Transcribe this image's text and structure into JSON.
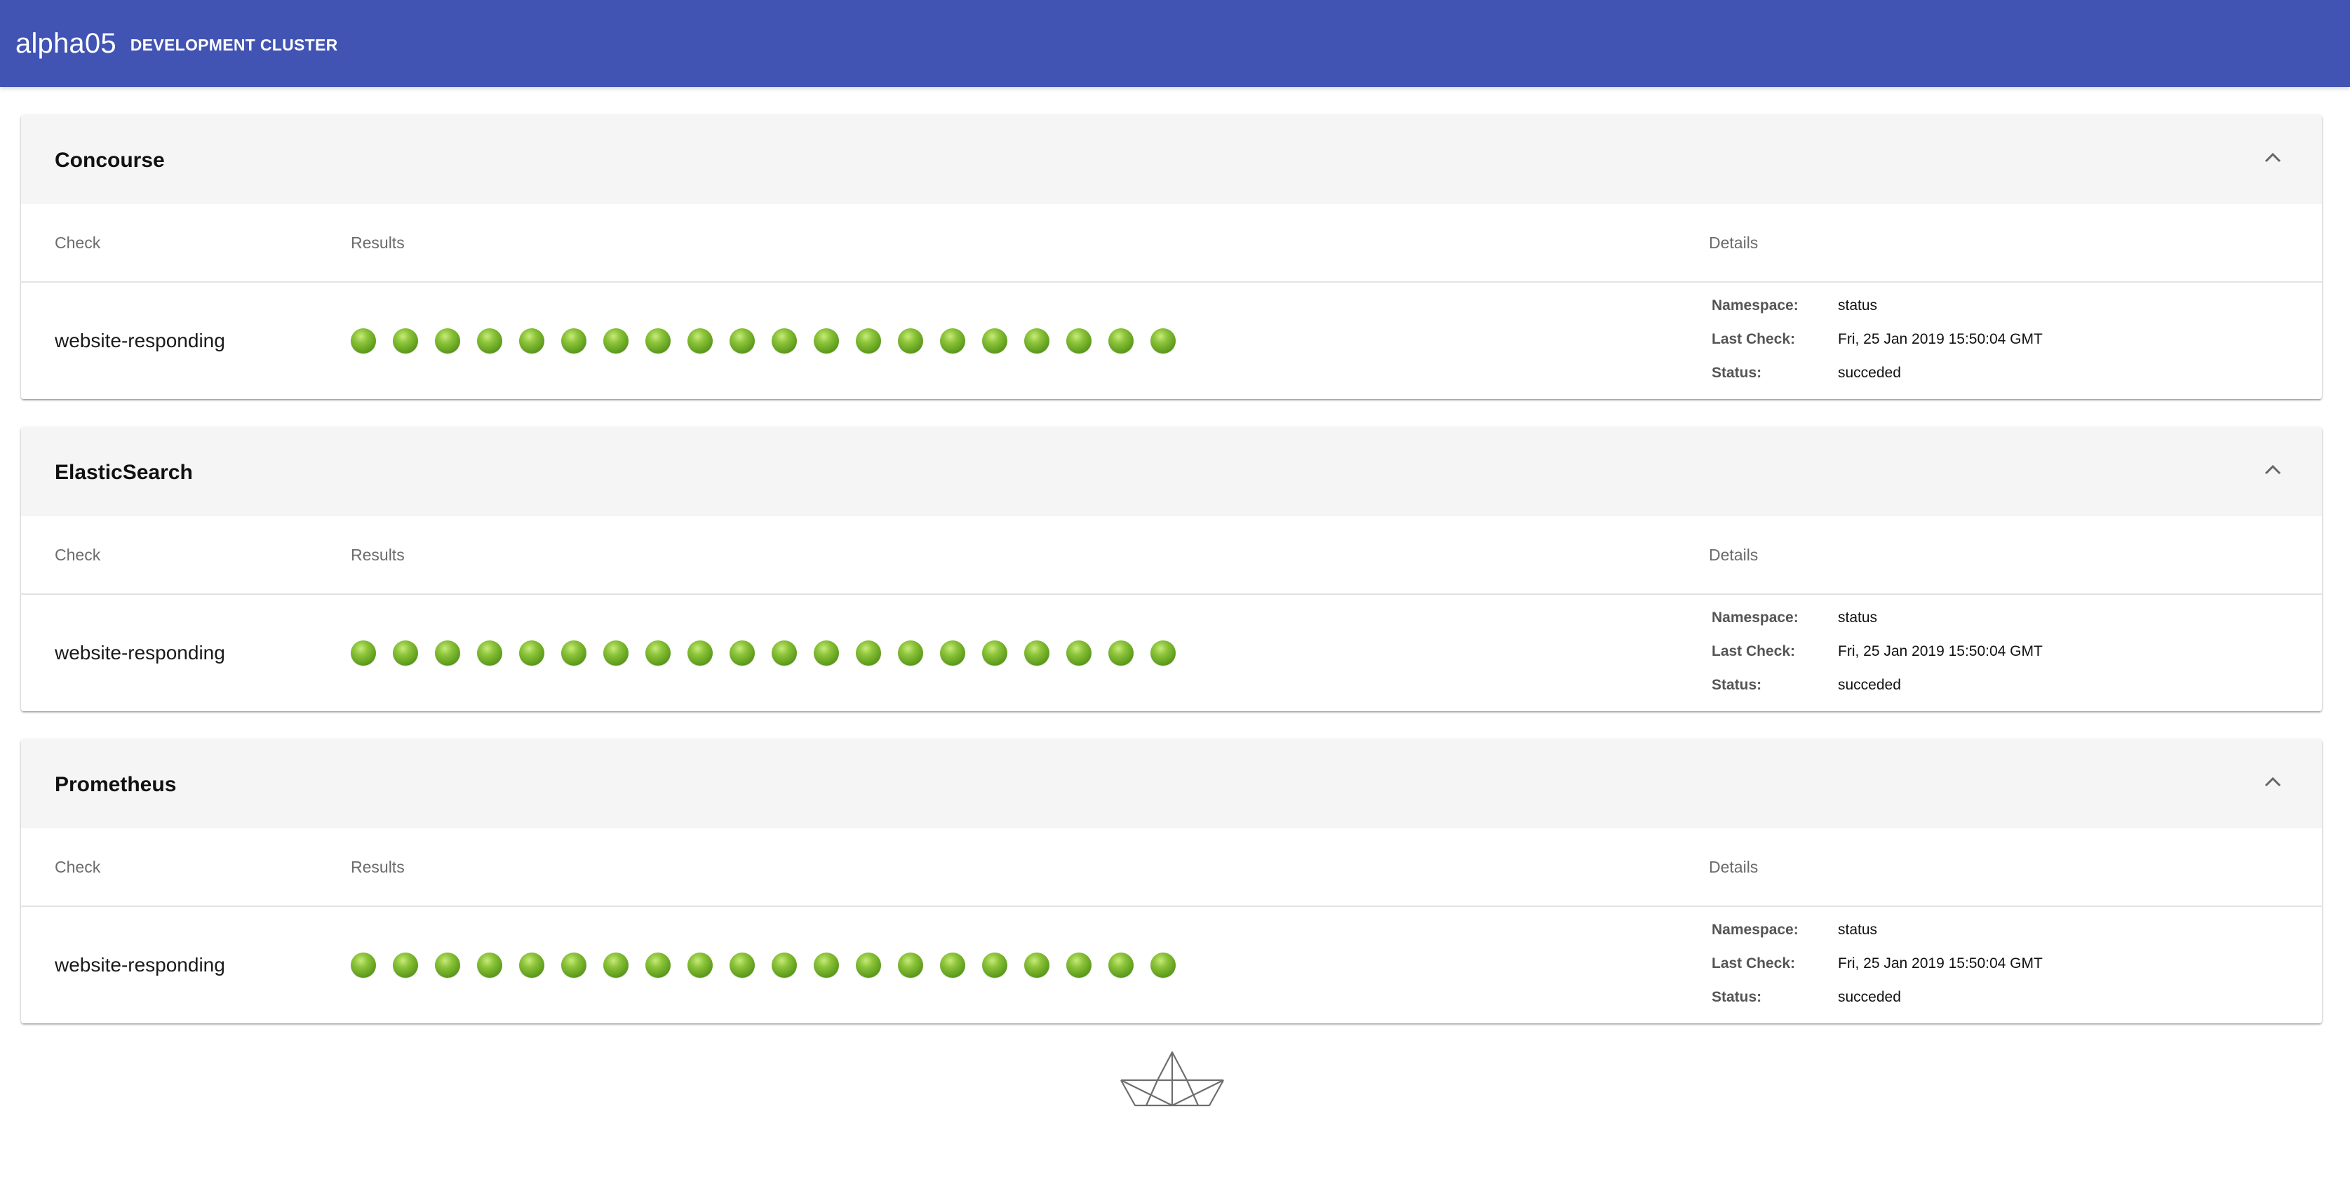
{
  "app": {
    "title": "alpha05",
    "subtitle": "DEVELOPMENT CLUSTER",
    "bar_color": "#4153b3"
  },
  "columns": {
    "check": "Check",
    "results": "Results",
    "details": "Details"
  },
  "detail_labels": {
    "namespace": "Namespace:",
    "last_check": "Last Check:",
    "status": "Status:"
  },
  "status_color": "#6aab24",
  "panels": [
    {
      "title": "Concourse",
      "expanded": true,
      "checks": [
        {
          "name": "website-responding",
          "results": [
            "ok",
            "ok",
            "ok",
            "ok",
            "ok",
            "ok",
            "ok",
            "ok",
            "ok",
            "ok",
            "ok",
            "ok",
            "ok",
            "ok",
            "ok",
            "ok",
            "ok",
            "ok",
            "ok",
            "ok"
          ],
          "namespace": "status",
          "last_check": "Fri, 25 Jan 2019 15:50:04 GMT",
          "status": "succeded"
        }
      ]
    },
    {
      "title": "ElasticSearch",
      "expanded": true,
      "checks": [
        {
          "name": "website-responding",
          "results": [
            "ok",
            "ok",
            "ok",
            "ok",
            "ok",
            "ok",
            "ok",
            "ok",
            "ok",
            "ok",
            "ok",
            "ok",
            "ok",
            "ok",
            "ok",
            "ok",
            "ok",
            "ok",
            "ok",
            "ok"
          ],
          "namespace": "status",
          "last_check": "Fri, 25 Jan 2019 15:50:04 GMT",
          "status": "succeded"
        }
      ]
    },
    {
      "title": "Prometheus",
      "expanded": true,
      "checks": [
        {
          "name": "website-responding",
          "results": [
            "ok",
            "ok",
            "ok",
            "ok",
            "ok",
            "ok",
            "ok",
            "ok",
            "ok",
            "ok",
            "ok",
            "ok",
            "ok",
            "ok",
            "ok",
            "ok",
            "ok",
            "ok",
            "ok",
            "ok"
          ],
          "namespace": "status",
          "last_check": "Fri, 25 Jan 2019 15:50:04 GMT",
          "status": "succeded"
        }
      ]
    }
  ],
  "footer": {
    "logo_icon": "paper-boat-icon"
  }
}
